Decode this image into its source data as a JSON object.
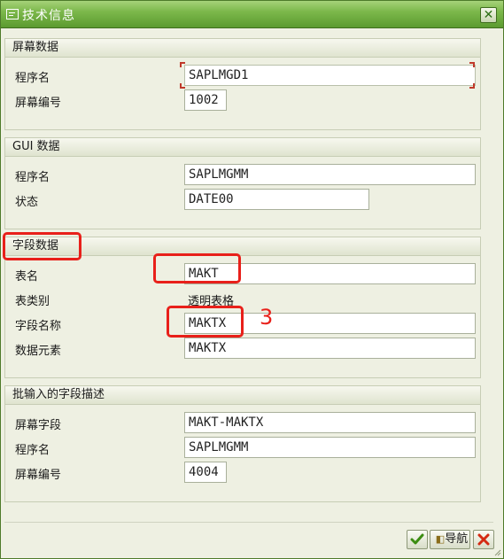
{
  "window": {
    "title": "技术信息"
  },
  "groups": {
    "screen": {
      "header": "屏幕数据",
      "rows": [
        {
          "label": "程序名",
          "value": "SAPLMGD1"
        },
        {
          "label": "屏幕编号",
          "value": "1002"
        }
      ]
    },
    "gui": {
      "header": "GUI 数据",
      "rows": [
        {
          "label": "程序名",
          "value": "SAPLMGMM"
        },
        {
          "label": "状态",
          "value": "DATE00"
        }
      ]
    },
    "field": {
      "header": "字段数据",
      "rows": [
        {
          "label": "表名",
          "value": "MAKT"
        },
        {
          "label": "表类别",
          "value": "透明表格"
        },
        {
          "label": "字段名称",
          "value": "MAKTX"
        },
        {
          "label": "数据元素",
          "value": "MAKTX"
        }
      ]
    },
    "batch": {
      "header": "批输入的字段描述",
      "rows": [
        {
          "label": "屏幕字段",
          "value": "MAKT-MAKTX"
        },
        {
          "label": "程序名",
          "value": "SAPLMGMM"
        },
        {
          "label": "屏幕编号",
          "value": "4004"
        }
      ]
    }
  },
  "annotation": {
    "number": "3",
    "color": "#e8201a"
  },
  "buttons": {
    "navigate_label": "导航"
  },
  "icons": {
    "title": "dialog-info-icon",
    "close": "close-icon",
    "confirm": "checkmark-icon",
    "navigate": "navigation-icon",
    "cancel": "cancel-x-icon"
  },
  "colors": {
    "titlebar": "#7cb84b",
    "accent_red": "#e8201a",
    "confirm_green": "#3c8d12"
  }
}
